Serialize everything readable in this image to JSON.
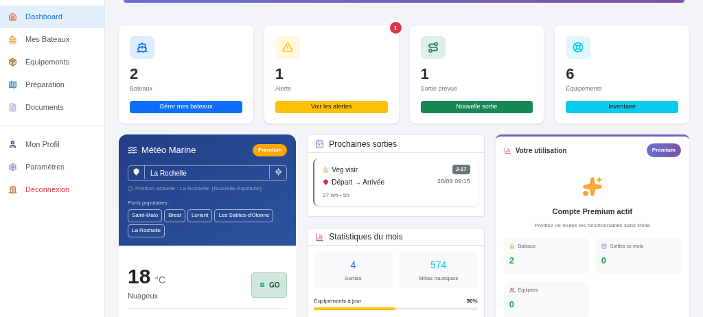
{
  "sidebar": {
    "nav_items": [
      {
        "label": "Dashboard",
        "selected": true,
        "kind": "link"
      },
      {
        "label": "Mes Bateaux",
        "selected": false,
        "kind": "link"
      },
      {
        "label": "Équipements",
        "selected": false,
        "kind": "link"
      },
      {
        "label": "Préparation",
        "selected": false,
        "kind": "link"
      },
      {
        "label": "Documents",
        "selected": false,
        "kind": "link"
      }
    ],
    "account_items": [
      {
        "label": "Mon Profil",
        "selected": false,
        "kind": "link"
      },
      {
        "label": "Paramètres",
        "selected": false,
        "kind": "link"
      },
      {
        "label": "Déconnexion",
        "selected": false,
        "kind": "danger"
      }
    ]
  },
  "stat_cards": [
    {
      "value": "2",
      "label": "Bateaux",
      "button": "Gérer mes bateaux",
      "color": "#0d6efd"
    },
    {
      "value": "1",
      "label": "Alerte",
      "button": "Voir les alertes",
      "color": "#ffc107",
      "badge": "1"
    },
    {
      "value": "1",
      "label": "Sortie prévue",
      "button": "Nouvelle sortie",
      "color": "#198754"
    },
    {
      "value": "6",
      "label": "Équipements",
      "button": "Inventaire",
      "color": "#0dcaf0"
    }
  ],
  "weather": {
    "title": "Météo Marine",
    "badge": "Premium",
    "location": "La Rochelle",
    "position_note": "Position actuelle : La Rochelle  (Nouvelle-Aquitaine)",
    "ports_label": "Ports populaires :",
    "ports": [
      "Saint-Malo",
      "Brest",
      "Lorient",
      "Les Sables-d'Olonne",
      "La Rochelle"
    ],
    "temperature": "18",
    "unit": "°C",
    "condition": "Nuageux",
    "verdict": "GO"
  },
  "trips": {
    "title": "Prochaines sorties",
    "items": [
      {
        "boat": "Veg visir",
        "route": "Départ → Arrivée",
        "details": "27 nm • 5h",
        "countdown": "J-17",
        "datetime": "28/09 09:15"
      }
    ]
  },
  "monthly_stats": {
    "title": "Statistiques du mois",
    "tiles": [
      {
        "value": "4",
        "label": "Sorties",
        "color": "#0d6efd"
      },
      {
        "value": "574",
        "label": "Milles nautiques",
        "color": "#0dcaf0"
      }
    ],
    "progress": {
      "label": "Équipements à jour",
      "reading": "50%",
      "level": 0.5
    }
  },
  "usage": {
    "title": "Votre utilisation",
    "badge": "Premium",
    "heading": "Compte Premium actif",
    "subtitle": "Profitez de toutes les fonctionnalités sans limite",
    "tiles": [
      {
        "label": "Bateaux",
        "value": "2"
      },
      {
        "label": "Sorties ce mois",
        "value": "0"
      },
      {
        "label": "Équipiers",
        "value": "0"
      }
    ]
  }
}
